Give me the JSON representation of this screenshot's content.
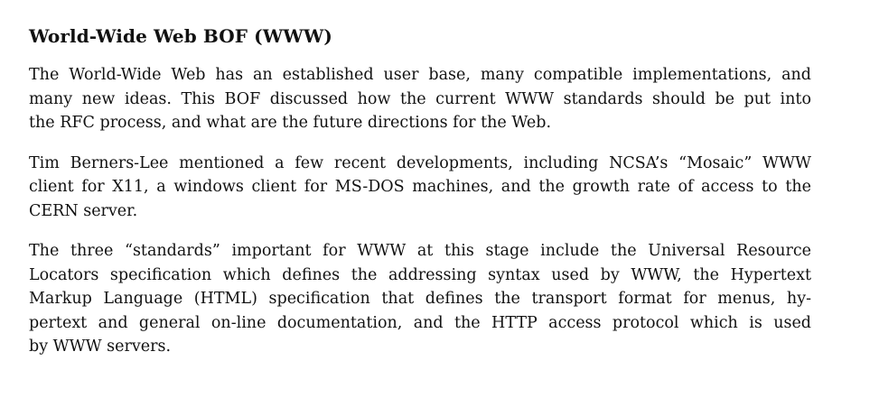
{
  "heading": "World-Wide Web BOF (WWW)",
  "paragraphs": [
    {
      "lines": [
        "The World-Wide Web has an established user base, many compatible implementations, and",
        "many new ideas. This BOF discussed how the current WWW standards should be put into",
        "the RFC process, and what are the future directions for the Web."
      ]
    },
    {
      "lines": [
        "Tim Berners-Lee mentioned a few recent developments, including NCSA’s “Mosaic” WWW",
        "client for X11, a windows client for MS-DOS machines, and the growth rate of access to the",
        "CERN server."
      ]
    },
    {
      "lines": [
        "The three “standards” important for WWW at this stage include the Universal Resource",
        "Locators specification which defines the addressing syntax used by WWW, the Hypertext",
        "Markup Language (HTML) specification that defines the transport format for menus, hy-",
        "pertext and general on-line documentation, and the HTTP access protocol which is used",
        "by WWW servers."
      ]
    }
  ]
}
